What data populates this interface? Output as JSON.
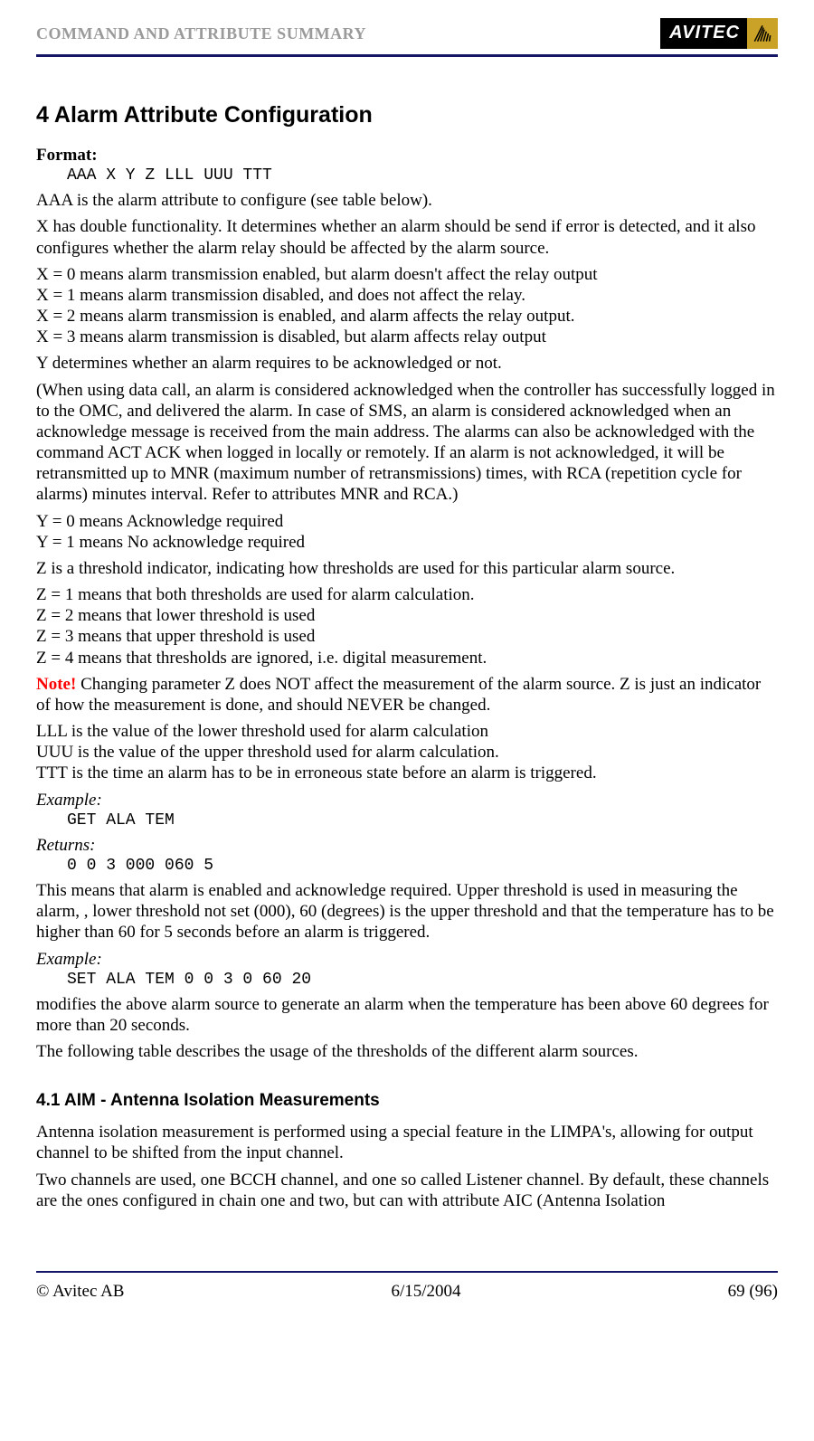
{
  "header": {
    "title": "COMMAND AND ATTRIBUTE SUMMARY",
    "logo_text": "AVITEC"
  },
  "section4": {
    "heading": "4  Alarm Attribute Configuration",
    "format_label": "Format:",
    "format_code": "AAA X Y Z LLL UUU TTT",
    "p1": "AAA is the alarm attribute to configure (see table below).",
    "p2": "X has double functionality. It determines whether an alarm should be send if error is detected, and it also configures whether the alarm relay should be affected by the alarm source.",
    "x0": "X = 0 means alarm transmission enabled, but alarm doesn't affect the relay output",
    "x1": "X = 1 means alarm transmission disabled, and does not affect the relay.",
    "x2": "X = 2 means alarm transmission is enabled, and alarm affects the relay output.",
    "x3": "X = 3 means alarm transmission is disabled, but alarm affects relay output",
    "p3": "Y determines whether an alarm requires to be acknowledged or not.",
    "p4": "(When using data call, an alarm is considered acknowledged when the controller has successfully logged in to the OMC, and delivered the alarm. In case of SMS, an alarm is considered acknowledged when an acknowledge message is received from the main address. The alarms can also be acknowledged with the command ACT ACK when logged in locally or remotely. If an alarm is not acknowledged, it will be retransmitted up to MNR (maximum number of retransmissions) times, with RCA (repetition cycle for alarms) minutes interval. Refer to attributes MNR and RCA.)",
    "y0": "Y = 0 means Acknowledge required",
    "y1": "Y = 1 means No acknowledge required",
    "p5": "Z is a threshold indicator, indicating how thresholds are used for this particular alarm source.",
    "z1": "Z = 1 means that both thresholds are used for alarm calculation.",
    "z2": "Z = 2 means that lower threshold is used",
    "z3": "Z = 3 means that upper threshold is used",
    "z4": "Z = 4 means that thresholds are ignored, i.e. digital measurement.",
    "note_label": "Note!",
    "note_text": " Changing parameter Z does NOT affect the measurement of the alarm source. Z is just an indicator of how the measurement is done, and should NEVER be changed.",
    "lll": "LLL is the value of the lower threshold used for alarm calculation",
    "uuu": "UUU is the value of the upper threshold used for alarm calculation.",
    "ttt": "TTT is the time an alarm has to be in erroneous state before an alarm is triggered.",
    "example1_label": "Example:",
    "example1_code": "GET ALA TEM",
    "returns_label": "Returns:",
    "returns_code": "0 0 3 000 060 5",
    "p6": "This means that alarm is enabled and acknowledge required. Upper threshold is used in measuring the alarm, , lower threshold not set (000),  60 (degrees) is the upper threshold and that the temperature has to be higher than 60 for 5 seconds before an alarm is triggered.",
    "example2_label": "Example:",
    "example2_code": "SET ALA TEM 0 0 3 0 60 20",
    "p7": "modifies the above alarm source to generate an alarm when the temperature has been above 60 degrees for more than 20 seconds.",
    "p8": "The following table describes the usage of the thresholds of the different alarm sources."
  },
  "section41": {
    "heading": "4.1        AIM - Antenna Isolation Measurements",
    "p1": "Antenna isolation measurement is performed using a special feature in the LIMPA's, allowing for output channel to be shifted from the input channel.",
    "p2": "Two channels are used, one BCCH channel, and one so called Listener channel. By default, these channels are the ones configured in chain one and two, but can with attribute AIC (Antenna Isolation"
  },
  "footer": {
    "left": "© Avitec AB",
    "center": "6/15/2004",
    "right": "69 (96)"
  }
}
